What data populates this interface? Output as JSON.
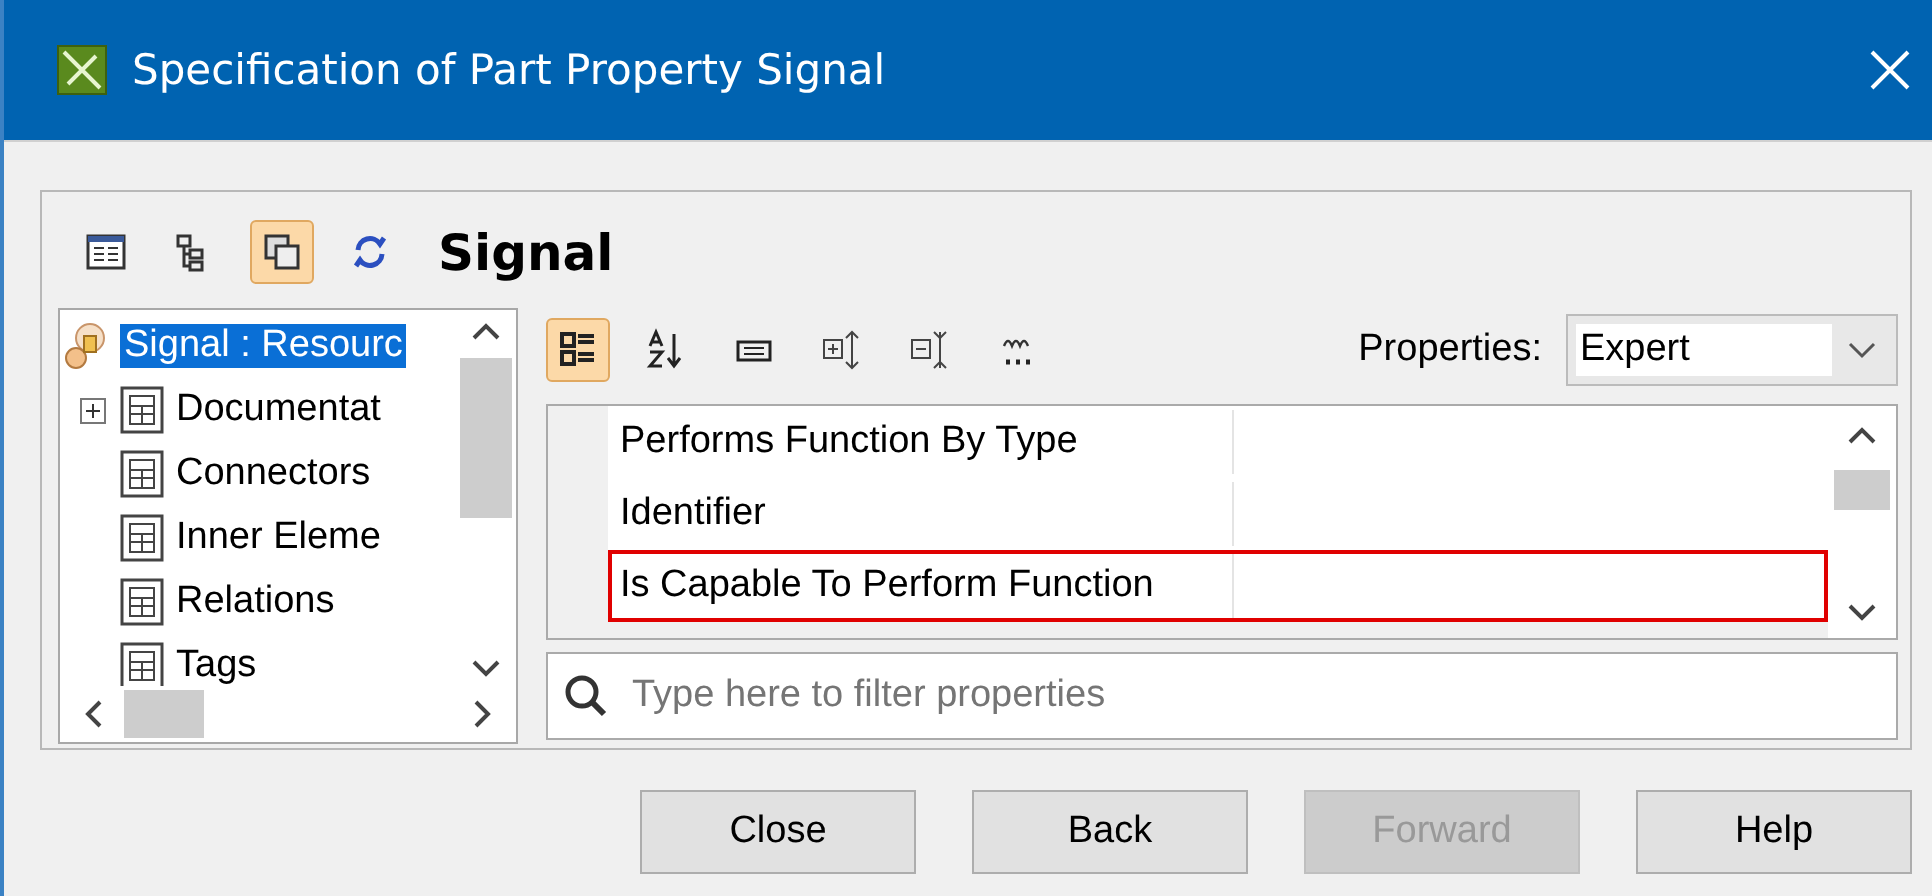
{
  "window": {
    "title": "Specification of Part Property Signal"
  },
  "toolbar": [
    {
      "selected": false
    },
    {
      "selected": false
    },
    {
      "selected": true
    },
    {
      "selected": false
    }
  ],
  "heading": "Signal",
  "tree": {
    "root": {
      "label": "Signal : Resourc",
      "selected": true,
      "children": [
        {
          "label": "Documentat",
          "has_children": true
        },
        {
          "label": "Connectors",
          "has_children": false
        },
        {
          "label": "Inner Eleme",
          "has_children": false
        },
        {
          "label": "Relations",
          "has_children": false
        },
        {
          "label": "Tags",
          "has_children": false
        }
      ]
    }
  },
  "properties_toolbar": [
    {
      "selected": true
    },
    {
      "selected": false
    },
    {
      "selected": false
    },
    {
      "selected": false
    },
    {
      "selected": false
    },
    {
      "selected": false
    }
  ],
  "properties_label": "Properties:",
  "properties_mode": "Expert",
  "property_rows": [
    {
      "name": "Performs Function By Type",
      "highlighted": false
    },
    {
      "name": "Identifier",
      "highlighted": false
    },
    {
      "name": "Is Capable To Perform Function",
      "highlighted": true
    }
  ],
  "filter": {
    "placeholder": "Type here to filter properties"
  },
  "buttons": [
    {
      "label": "Close",
      "disabled": false
    },
    {
      "label": "Back",
      "disabled": false
    },
    {
      "label": "Forward",
      "disabled": true
    },
    {
      "label": "Help",
      "disabled": false
    }
  ]
}
